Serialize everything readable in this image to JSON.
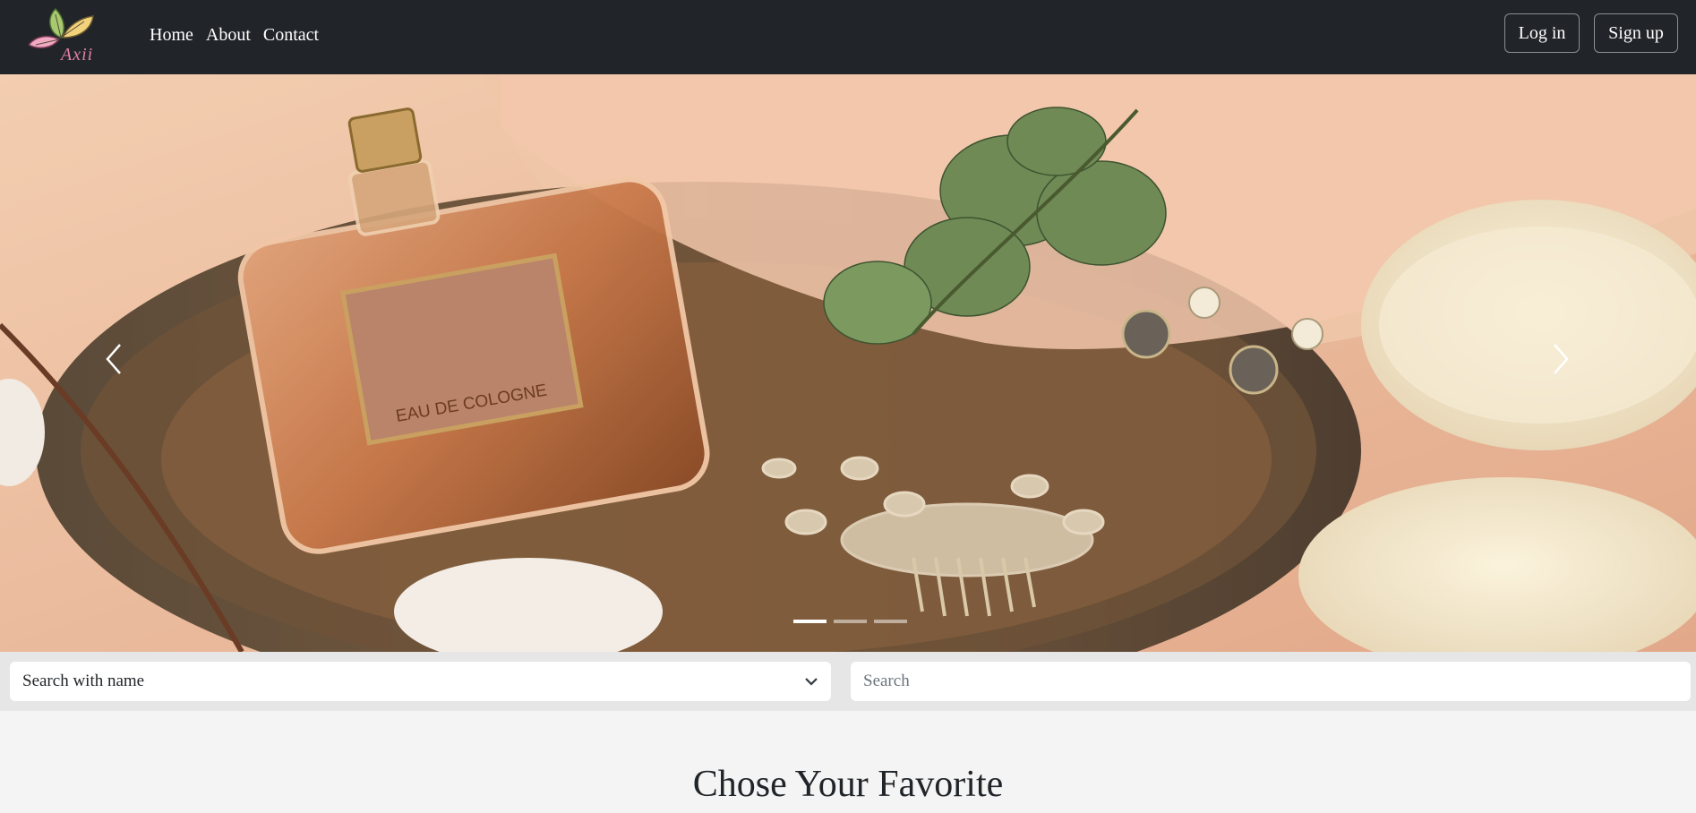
{
  "brand": {
    "logo_text": "Axii"
  },
  "nav": {
    "links": [
      "Home",
      "About",
      "Contact"
    ]
  },
  "auth": {
    "login_label": "Log in",
    "signup_label": "Sign up"
  },
  "hero": {
    "label_text": "EAU DE COLOGNE",
    "active_slide": 1,
    "slide_count": 3
  },
  "search": {
    "select_value": "Search with name",
    "input_placeholder": "Search"
  },
  "section": {
    "title": "Chose Your Favorite"
  },
  "colors": {
    "navbar": "#212529",
    "page_bg": "#f4f4f4",
    "search_bar_bg": "#e6e6e6"
  }
}
